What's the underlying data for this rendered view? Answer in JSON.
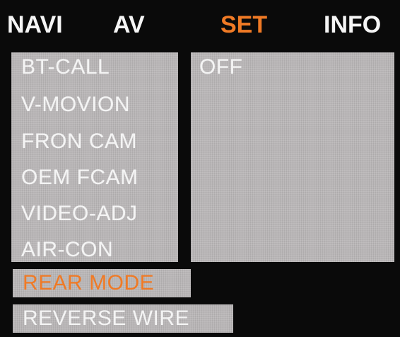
{
  "tabs": [
    {
      "label": "NAVI",
      "active": false
    },
    {
      "label": "AV",
      "active": false
    },
    {
      "label": "SET",
      "active": true
    },
    {
      "label": "INFO",
      "active": false
    }
  ],
  "menu": {
    "items": [
      {
        "label": "BT-CALL"
      },
      {
        "label": "V-MOVION"
      },
      {
        "label": "FRON CAM"
      },
      {
        "label": "OEM FCAM"
      },
      {
        "label": "VIDEO-ADJ"
      },
      {
        "label": "AIR-CON"
      }
    ],
    "selected_value": "OFF"
  },
  "extra_items": {
    "rear_mode": "REAR MODE",
    "reverse_wire": "REVERSE WIRE"
  },
  "colors": {
    "background": "#0a0a0a",
    "panel": "#b9b6b7",
    "text": "#f4f4f4",
    "accent": "#f07a25"
  }
}
